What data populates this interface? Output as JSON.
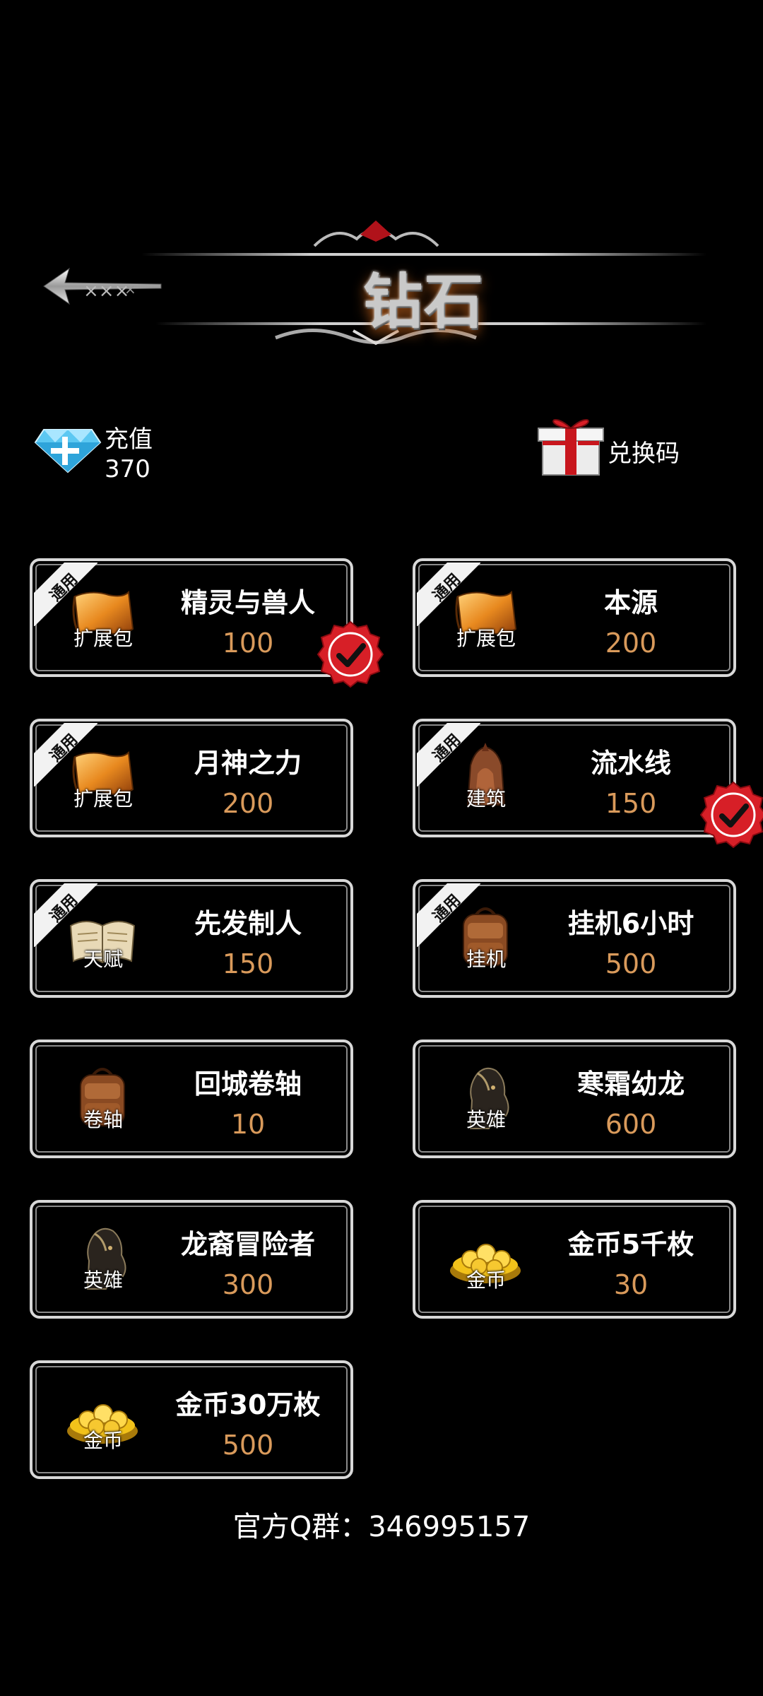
{
  "header": {
    "title": "钻石",
    "back_icon": "arrow-back-icon"
  },
  "topbar": {
    "recharge": {
      "icon": "diamond-plus-icon",
      "label": "充值",
      "amount": "370"
    },
    "redeem": {
      "icon": "gift-box-icon",
      "label": "兑换码"
    }
  },
  "colors": {
    "price": "#d99a5b",
    "card_border": "#d8d8d8",
    "badge_red": "#d71f27"
  },
  "items": [
    {
      "name": "精灵与兽人",
      "price": "100",
      "category": "扩展包",
      "tag": "通用",
      "icon": "scroll-icon",
      "owned": true
    },
    {
      "name": "本源",
      "price": "200",
      "category": "扩展包",
      "tag": "通用",
      "icon": "scroll-icon",
      "owned": false
    },
    {
      "name": "月神之力",
      "price": "200",
      "category": "扩展包",
      "tag": "通用",
      "icon": "scroll-icon",
      "owned": false
    },
    {
      "name": "流水线",
      "price": "150",
      "category": "建筑",
      "tag": "通用",
      "icon": "building-icon",
      "owned": true
    },
    {
      "name": "先发制人",
      "price": "150",
      "category": "天赋",
      "tag": "通用",
      "icon": "book-icon",
      "owned": false
    },
    {
      "name": "挂机6小时",
      "price": "500",
      "category": "挂机",
      "tag": "通用",
      "icon": "backpack-icon",
      "owned": false
    },
    {
      "name": "回城卷轴",
      "price": "10",
      "category": "卷轴",
      "tag": "",
      "icon": "backpack-icon",
      "owned": false
    },
    {
      "name": "寒霜幼龙",
      "price": "600",
      "category": "英雄",
      "tag": "",
      "icon": "horse-head-icon",
      "owned": false
    },
    {
      "name": "龙裔冒险者",
      "price": "300",
      "category": "英雄",
      "tag": "",
      "icon": "horse-head-icon",
      "owned": false
    },
    {
      "name": "金币5千枚",
      "price": "30",
      "category": "金币",
      "tag": "",
      "icon": "gold-coins-icon",
      "owned": false
    },
    {
      "name": "金币30万枚",
      "price": "500",
      "category": "金币",
      "tag": "",
      "icon": "gold-coins-icon",
      "owned": false
    }
  ],
  "footer": {
    "qq_group": "官方Q群：346995157"
  }
}
